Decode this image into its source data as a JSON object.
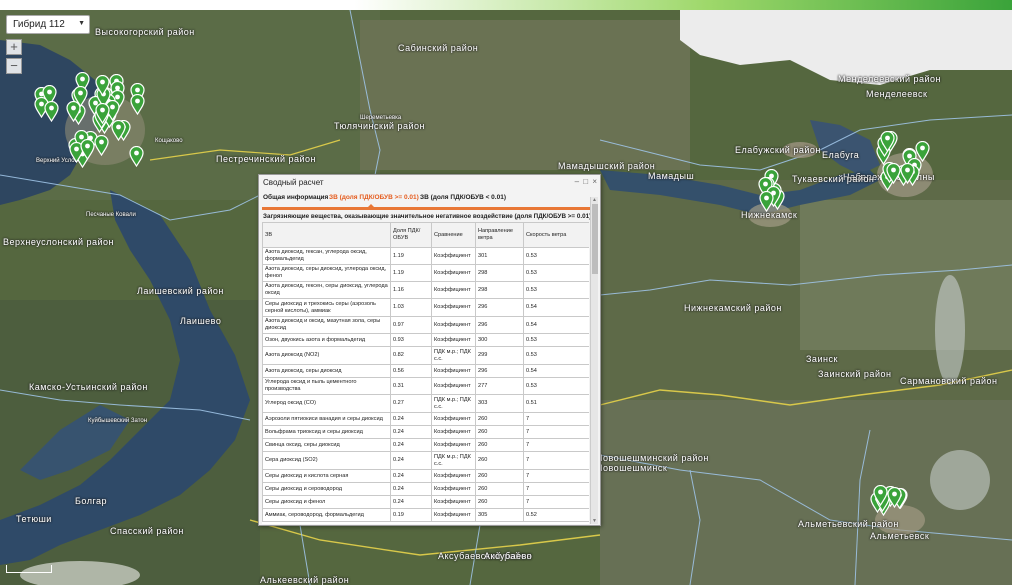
{
  "layer_select": {
    "value": "Гибрид 112"
  },
  "zoom": {
    "in": "+",
    "out": "−"
  },
  "map": {
    "regions": [
      "Высокогорский район",
      "Сабинский район",
      "Тюлячинский район",
      "Пестречинский район",
      "Елабужский район",
      "Мамадыш",
      "Менделеевский район",
      "Менделеевск",
      "Елабуга",
      "Набережные Челны",
      "Тукаевский район",
      "Нижнекамск",
      "Нижнекамский район",
      "Заинск",
      "Заинский район",
      "Сармановский район",
      "Лаишевский район",
      "Камско-Устьинский район",
      "Верхнеуслонский район",
      "Альметьевский район",
      "Альметьевск",
      "Новошешминский район",
      "Новошешминск",
      "Аксубаевский район",
      "Аксубаево",
      "Алькеевский район",
      "Спасский район",
      "Болгар",
      "Тетюши",
      "Лаишево",
      "Мамадышский район"
    ],
    "small_labels": [
      "Куйбышевский Затон",
      "Песчаные Ковали",
      "Верхний Услон",
      "Шереметьевка",
      "Кощаково"
    ]
  },
  "summary_window": {
    "title": "Сводный расчет",
    "window_buttons": [
      "–",
      "□",
      "×"
    ],
    "tabs": [
      "Общая информация",
      "ЗВ (доля ПДК/ОБУВ >= 0.01)",
      "ЗВ (доля ПДК/ОБУВ < 0.01)"
    ],
    "active_tab": 1,
    "section_title": "Загрязняющие вещества, оказывающие значительное негативное воздействие (доля ПДК/ОБУВ >= 0.01)",
    "columns": [
      "ЗВ",
      "Доля ПДК/ ОБУВ",
      "Сравнение",
      "Направление ветра",
      "Скорость ветра"
    ],
    "rows": [
      [
        "Азота диоксид, гексан, углерода оксид, формальдегид",
        "1.19",
        "Коэффициент",
        "301",
        "0.53"
      ],
      [
        "Азота диоксид, серы диоксид, углерода оксид, фенол",
        "1.19",
        "Коэффициент",
        "298",
        "0.53"
      ],
      [
        "Азота диоксид, гексен, серы диоксид, углерода оксид",
        "1.16",
        "Коэффициент",
        "298",
        "0.53"
      ],
      [
        "Серы диоксид и трехокись серы (аэрозоль серной кислоты), аммиак",
        "1.03",
        "Коэффициент",
        "296",
        "0.54"
      ],
      [
        "Азота диоксид и оксид, мазутная зола, серы диоксид",
        "0.97",
        "Коэффициент",
        "296",
        "0.54"
      ],
      [
        "Озон, двуокись азота и формальдегид",
        "0.93",
        "Коэффициент",
        "300",
        "0.53"
      ],
      [
        "Азота диоксид (NO2)",
        "0.82",
        "ПДК м.р.; ПДК с.с.",
        "299",
        "0.53"
      ],
      [
        "Азота диоксид, серы диоксид",
        "0.56",
        "Коэффициент",
        "296",
        "0.54"
      ],
      [
        "Углерода оксид и пыль цементного производства",
        "0.31",
        "Коэффициент",
        "277",
        "0.53"
      ],
      [
        "Углерод оксид (CO)",
        "0.27",
        "ПДК м.р.; ПДК с.с.",
        "303",
        "0.51"
      ],
      [
        "Аэрозоли пятиокиси ванадия и серы диоксид",
        "0.24",
        "Коэффициент",
        "260",
        "7"
      ],
      [
        "Вольфрама триоксид и серы диоксид",
        "0.24",
        "Коэффициент",
        "260",
        "7"
      ],
      [
        "Свинца оксид, серы диоксид",
        "0.24",
        "Коэффициент",
        "260",
        "7"
      ],
      [
        "Сера диоксид (SO2)",
        "0.24",
        "ПДК м.р.; ПДК с.с.",
        "260",
        "7"
      ],
      [
        "Серы диоксид и кислота серная",
        "0.24",
        "Коэффициент",
        "260",
        "7"
      ],
      [
        "Серы диоксид и сероводород",
        "0.24",
        "Коэффициент",
        "260",
        "7"
      ],
      [
        "Серы диоксид и фенол",
        "0.24",
        "Коэффициент",
        "260",
        "7"
      ],
      [
        "Аммиак, сероводород, формальдегид",
        "0.19",
        "Коэффициент",
        "305",
        "0.52"
      ]
    ]
  },
  "colors": {
    "accent": "#e55c1e",
    "tab_line": "#e87736",
    "pin": "#3aa33a"
  }
}
